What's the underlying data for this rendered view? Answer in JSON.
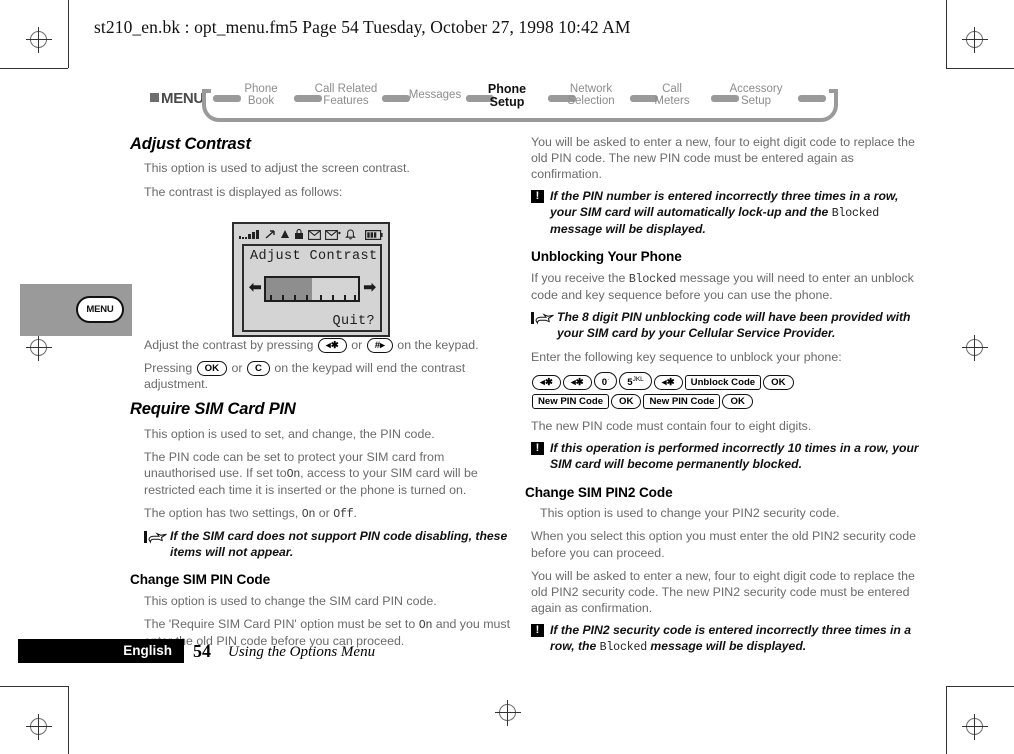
{
  "header": {
    "text": "st210_en.bk : opt_menu.fm5  Page 54  Tuesday, October 27, 1998  10:42 AM"
  },
  "breadcrumb": {
    "root": "MENU",
    "items": [
      {
        "label": "Phone\nBook",
        "active": false
      },
      {
        "label": "Call Related\nFeatures",
        "active": false
      },
      {
        "label": "Messages",
        "active": false
      },
      {
        "label": "Phone\nSetup",
        "active": true
      },
      {
        "label": "Network\nSelection",
        "active": false
      },
      {
        "label": "Call\nMeters",
        "active": false
      },
      {
        "label": "Accessory\nSetup",
        "active": false
      }
    ]
  },
  "side_tab": {
    "button_label": "MENU"
  },
  "phone_figure": {
    "status_icons": [
      "signal-bars-icon",
      "call-diverted-icon",
      "roaming-icon",
      "keypad-lock-icon",
      "envelope-icon",
      "voicemail-icon",
      "bell-icon",
      "battery-icon"
    ],
    "screen_title": "Adjust Contrast",
    "softkey": "Quit?",
    "contrast_fill_percent": 50
  },
  "left_column": {
    "section_title": "Adjust Contrast",
    "p1": "This option is used to adjust the screen contrast.",
    "p2": "The contrast is displayed as follows:",
    "p3_part1": "Adjust the contrast by pressing",
    "p3_key1": "◂✱",
    "p3_or": "or",
    "p3_key2": "#▸",
    "p3_part2": "on the keypad.",
    "p4_part1": "Pressing",
    "p4_key1": "OK",
    "p4_or": "or",
    "p4_key2": "C",
    "p4_part2": "on the keypad will end the contrast adjustment.",
    "section2_title": "Require SIM Card PIN",
    "s2_p1": "This option is used to set, and change, the PIN code.",
    "s2_p2_a": "The PIN code can be set to protect your SIM card from unauthorised use. If set to",
    "s2_p2_on": "On",
    "s2_p2_b": ", access to your SIM card will be restricted each time it is inserted or the phone is turned on.",
    "s2_p3_a": "The option has two settings,",
    "s2_p3_on": "On",
    "s2_p3_or": "or",
    "s2_p3_off": "Off",
    "s2_p3_b": ".",
    "s2_note": "If the SIM card does not support PIN code disabling, these items will not appear.",
    "subsection_title": "Change SIM PIN Code",
    "s3_p1": "This option is used to change the SIM card PIN code.",
    "s3_p2_a": "The 'Require SIM Card PIN' option must be set to",
    "s3_p2_on": "On",
    "s3_p2_b": "and you must enter the old PIN code before you can proceed."
  },
  "right_column": {
    "p1": "You will be asked to enter a new, four to eight digit code to replace the old PIN code. The new PIN code must be entered again as confirmation.",
    "warn1_a": "If the PIN number is entered incorrectly three times in a row, your SIM card will automatically lock-up and the",
    "warn1_mono": "Blocked",
    "warn1_b": "message will be displayed.",
    "warn_icon_glyph": "!",
    "section_title": "Unblocking Your Phone",
    "p2_a": "If you receive the",
    "p2_mono": "Blocked",
    "p2_b": "message you will need to enter an unblock code and key sequence before you can use the phone.",
    "note1": "The 8 digit PIN unblocking code will have been provided with your SIM card by your Cellular Service Provider.",
    "p3": "Enter the following key sequence to unblock your phone:",
    "key_sequence": [
      {
        "label": "◂✱",
        "shape": "round"
      },
      {
        "label": "◂✱",
        "shape": "round"
      },
      {
        "label": "0",
        "shape": "round",
        "sup": "·"
      },
      {
        "label": "5",
        "shape": "round",
        "sup": "JKL"
      },
      {
        "label": "◂✱",
        "shape": "round"
      },
      {
        "label": "Unblock Code",
        "shape": "rect"
      },
      {
        "label": "OK",
        "shape": "round"
      },
      {
        "label": "New PIN Code",
        "shape": "rect"
      },
      {
        "label": "OK",
        "shape": "round"
      },
      {
        "label": "New PIN Code",
        "shape": "rect"
      },
      {
        "label": "OK",
        "shape": "round"
      }
    ],
    "p4": "The new PIN code must contain four to eight digits.",
    "warn2": "If this operation is performed incorrectly 10 times in a row, your SIM card will become permanently blocked.",
    "section2_title": "Change SIM PIN2 Code",
    "p5": "This option is used to change your PIN2 security code.",
    "p6": "When you select this option you must enter the old PIN2 security code before you can proceed.",
    "p7": "You will be asked to enter a new, four to eight digit code to replace the old PIN2 security code. The new PIN2 security code must be entered again as confirmation.",
    "warn3_a": "If the PIN2 security code is entered incorrectly three times in a row, the",
    "warn3_mono": "Blocked",
    "warn3_b": "message will be displayed."
  },
  "footer": {
    "language": "English",
    "page_number": "54",
    "chapter_title": "Using the Options Menu"
  }
}
